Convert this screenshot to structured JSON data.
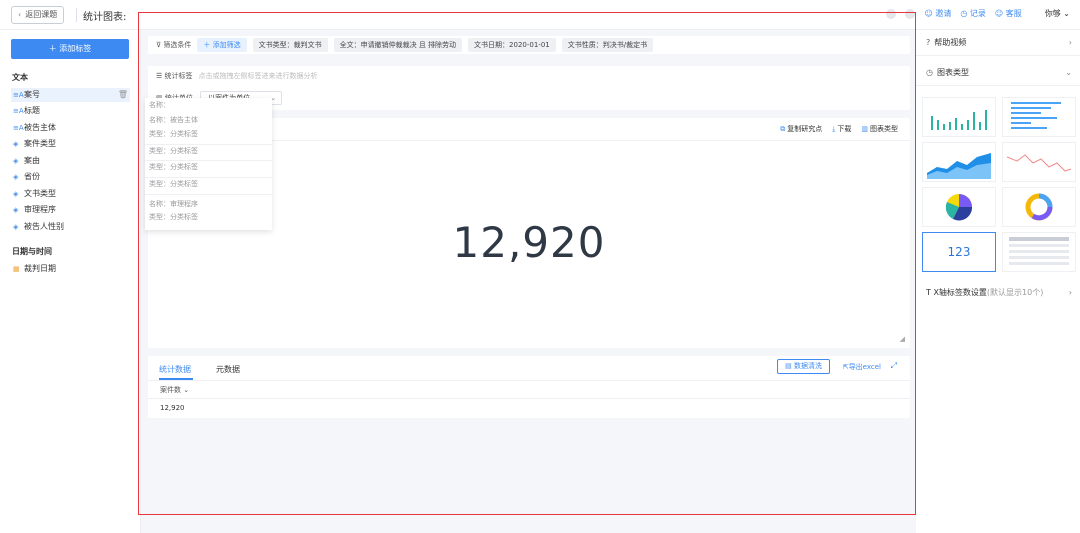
{
  "topbar": {
    "back_label": "返回课题",
    "chart_title_label": "统计图表:",
    "invite": "邀请",
    "record": "记录",
    "service": "客服",
    "user": "你够"
  },
  "sidebar": {
    "add_tag": "添加标签",
    "text_section": "文本",
    "text_items": [
      "案号",
      "标题",
      "被告主体",
      "案件类型",
      "案由",
      "省份",
      "文书类型",
      "审理程序",
      "被告人性别"
    ],
    "date_section": "日期与时间",
    "date_items": [
      "裁判日期"
    ]
  },
  "filters": {
    "label": "筛选条件",
    "add": "添加筛选",
    "chips": [
      "文书类型：裁判文书",
      "全文：申请撤销仲裁裁决 且 排除劳动",
      "文书日期：2020-01-01",
      "文书性质：判决书/裁定书"
    ]
  },
  "stat": {
    "tag_label": "统计标签",
    "tag_placeholder": "点击或拖拽左侧标签进来进行数据分析",
    "unit_label": "统计单位",
    "unit_value": "以案件为单位"
  },
  "dropdown": {
    "items": [
      "名称：",
      "名称：被告主体",
      "类型：分类标签",
      "类型：分类标签",
      "类型：分类标签",
      "类型：分类标签",
      "名称：审理程序",
      "类型：分类标签"
    ]
  },
  "chart": {
    "copy": "复制研究点",
    "download": "下载",
    "chart_type": "图表类型",
    "value": "12,920"
  },
  "data": {
    "tab_stat": "统计数据",
    "tab_meta": "元数据",
    "clean": "数据清洗",
    "export": "导出excel",
    "col_head": "案件数",
    "cell": "12,920"
  },
  "rightpanel": {
    "help": "帮助视频",
    "chart_type": "图表类型",
    "thumb_number": "123",
    "xaxis_label": "X轴标签数设置",
    "xaxis_hint": "(默认显示10个)"
  },
  "colors": {
    "accent": "#3d8bf2",
    "frame": "#e8373e"
  }
}
